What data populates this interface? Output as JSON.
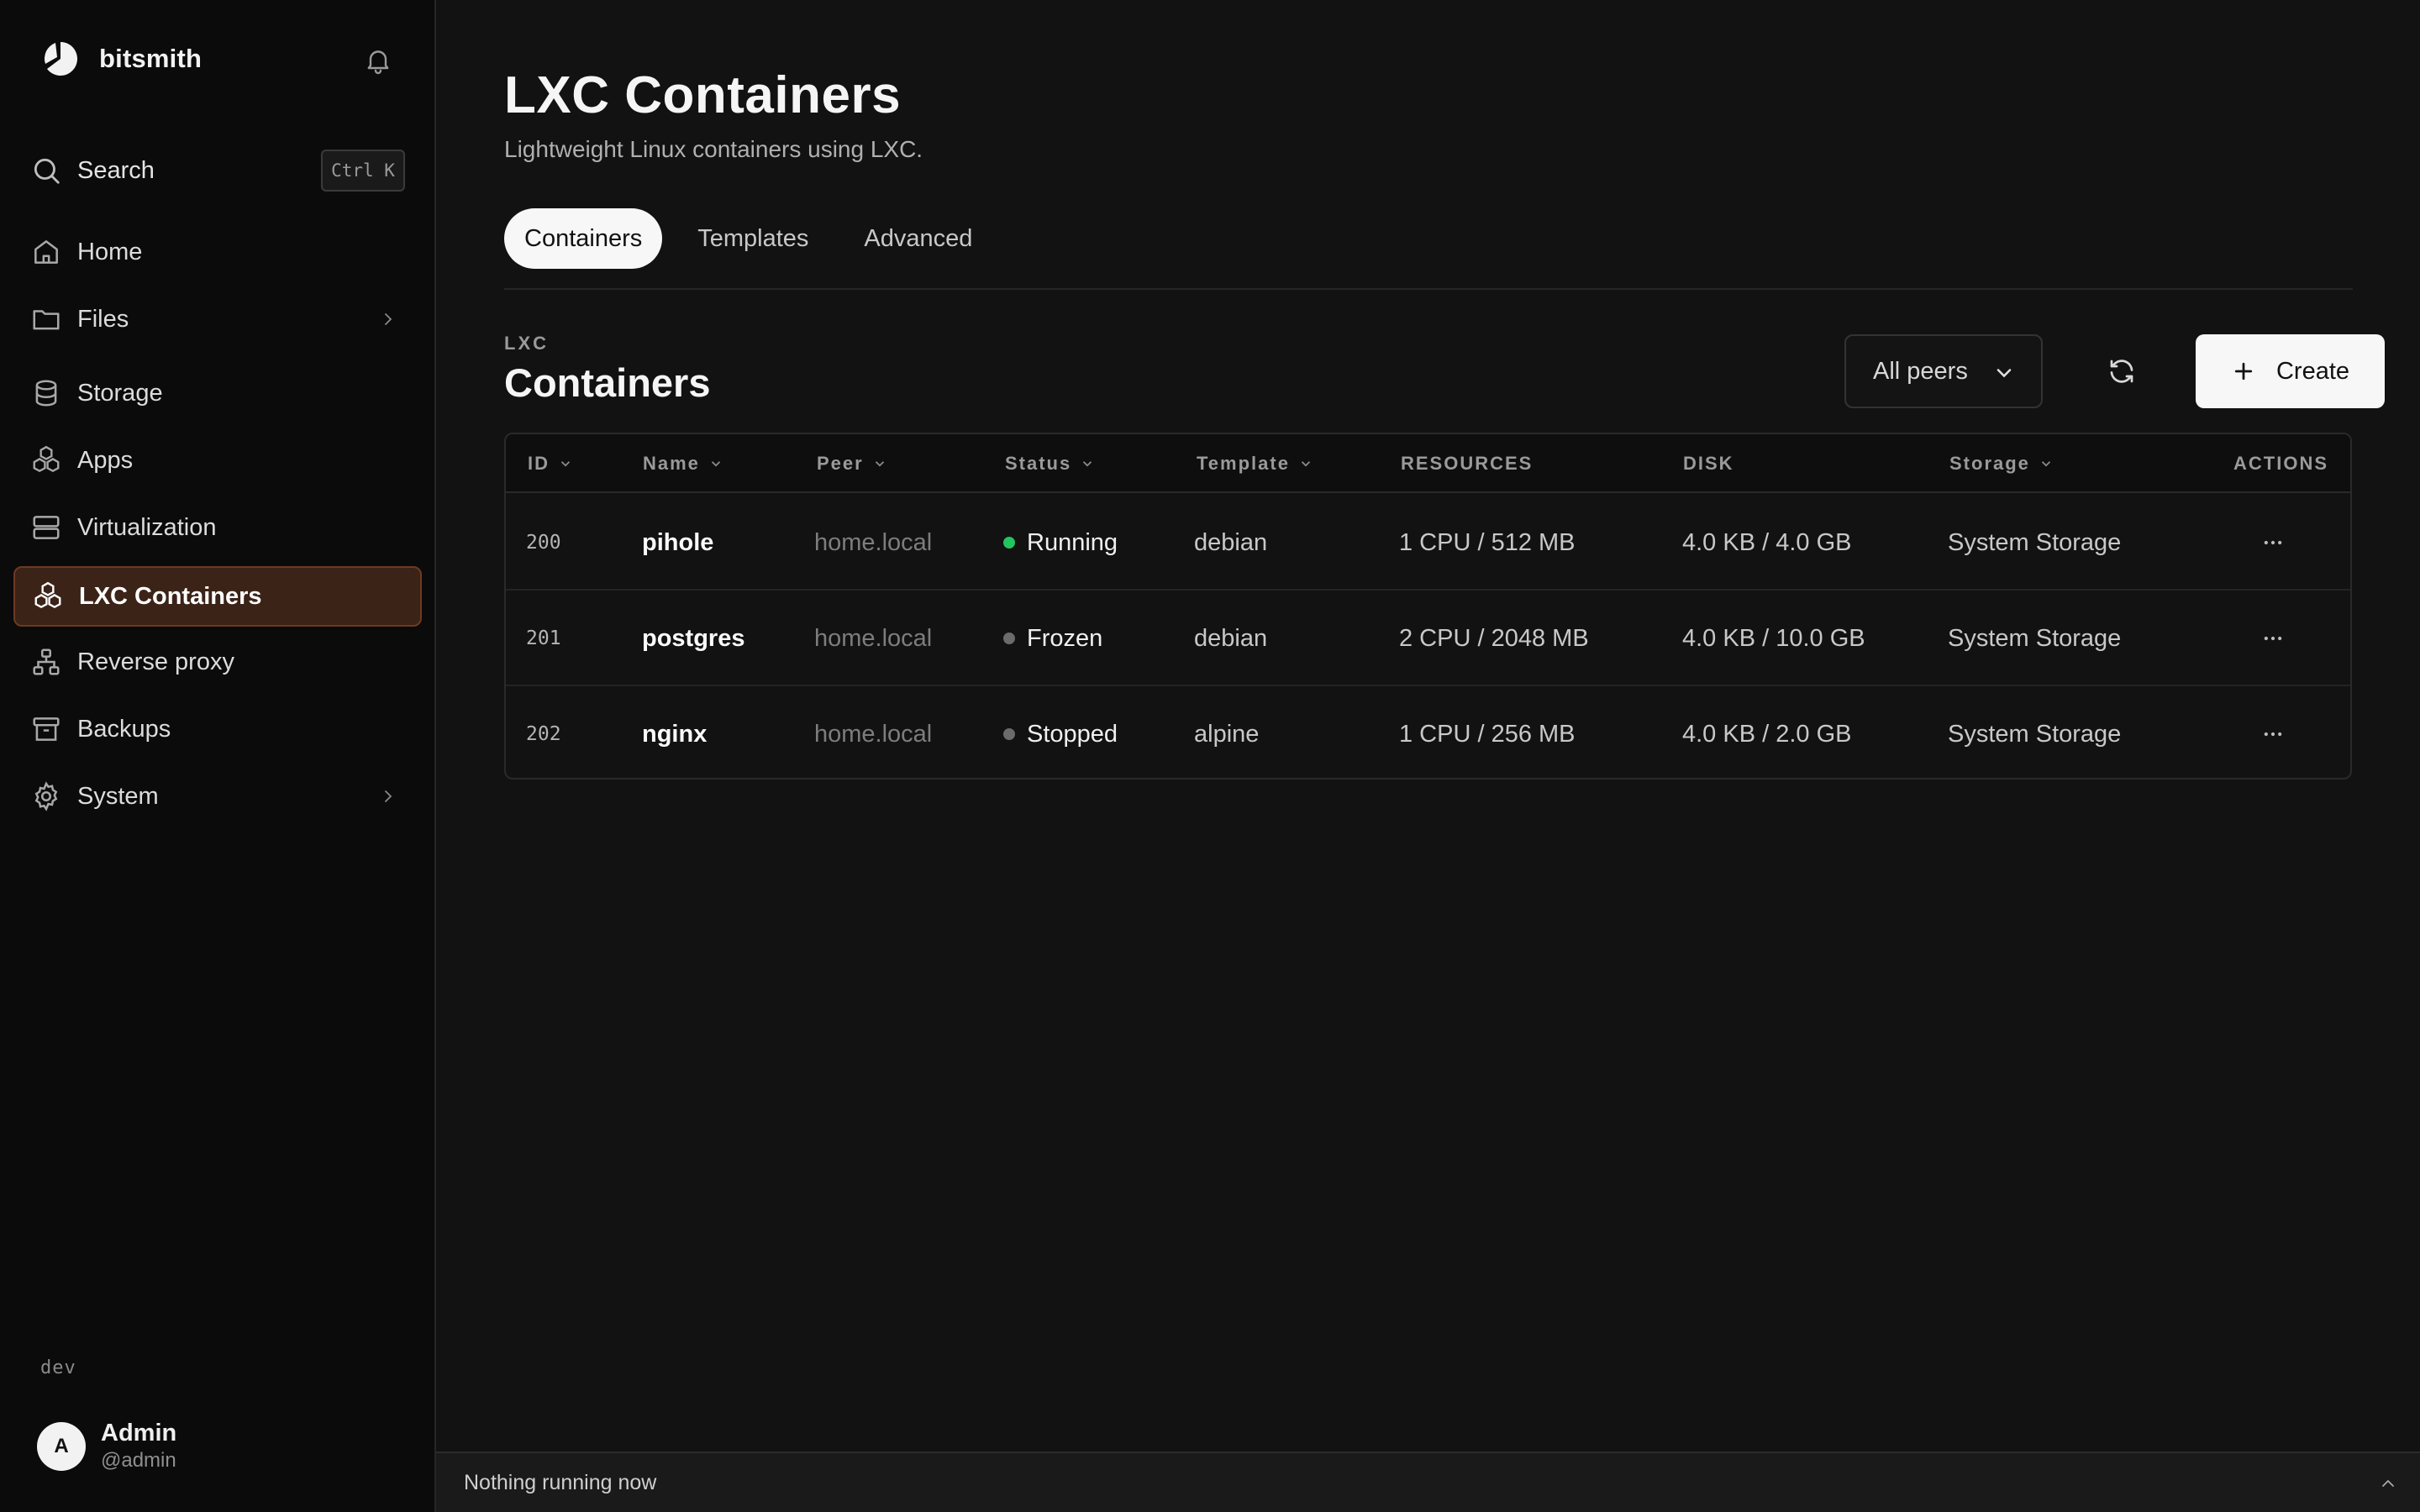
{
  "brand": {
    "name": "bitsmith"
  },
  "search": {
    "label": "Search",
    "shortcut": "Ctrl K"
  },
  "sidebar": {
    "items": [
      {
        "label": "Home",
        "icon": "home-icon"
      },
      {
        "label": "Files",
        "icon": "folder-icon",
        "has_children": true
      },
      {
        "label": "Storage",
        "icon": "database-icon"
      },
      {
        "label": "Apps",
        "icon": "apps-icon"
      },
      {
        "label": "Virtualization",
        "icon": "server-icon"
      },
      {
        "label": "LXC Containers",
        "icon": "containers-icon",
        "active": true
      },
      {
        "label": "Reverse proxy",
        "icon": "network-icon"
      },
      {
        "label": "Backups",
        "icon": "archive-icon"
      },
      {
        "label": "System",
        "icon": "gear-icon",
        "has_children": true
      }
    ],
    "env": "dev"
  },
  "user": {
    "initial": "A",
    "name": "Admin",
    "handle": "@admin"
  },
  "page": {
    "title": "LXC Containers",
    "subtitle": "Lightweight Linux containers using LXC."
  },
  "tabs": [
    {
      "label": "Containers",
      "active": true
    },
    {
      "label": "Templates"
    },
    {
      "label": "Advanced"
    }
  ],
  "section": {
    "eyebrow": "LXC",
    "title": "Containers"
  },
  "toolbar": {
    "peer_filter": "All peers",
    "create_label": "Create"
  },
  "table": {
    "columns": [
      "ID",
      "Name",
      "Peer",
      "Status",
      "Template",
      "RESOURCES",
      "DISK",
      "Storage",
      "ACTIONS"
    ],
    "rows": [
      {
        "id": "200",
        "name": "pihole",
        "peer": "home.local",
        "status": "Running",
        "status_color": "#22c55e",
        "template": "debian",
        "resources": "1 CPU / 512 MB",
        "disk": "4.0 KB / 4.0 GB",
        "storage": "System Storage"
      },
      {
        "id": "201",
        "name": "postgres",
        "peer": "home.local",
        "status": "Frozen",
        "status_color": "#6b6b6b",
        "template": "debian",
        "resources": "2 CPU / 2048 MB",
        "disk": "4.0 KB / 10.0 GB",
        "storage": "System Storage"
      },
      {
        "id": "202",
        "name": "nginx",
        "peer": "home.local",
        "status": "Stopped",
        "status_color": "#6b6b6b",
        "template": "alpine",
        "resources": "1 CPU / 256 MB",
        "disk": "4.0 KB / 2.0 GB",
        "storage": "System Storage"
      }
    ]
  },
  "bottom_bar": {
    "status": "Nothing running now"
  },
  "colors": {
    "accent_bg": "#3b2318",
    "accent_border": "#6e3a22",
    "running": "#22c55e"
  }
}
